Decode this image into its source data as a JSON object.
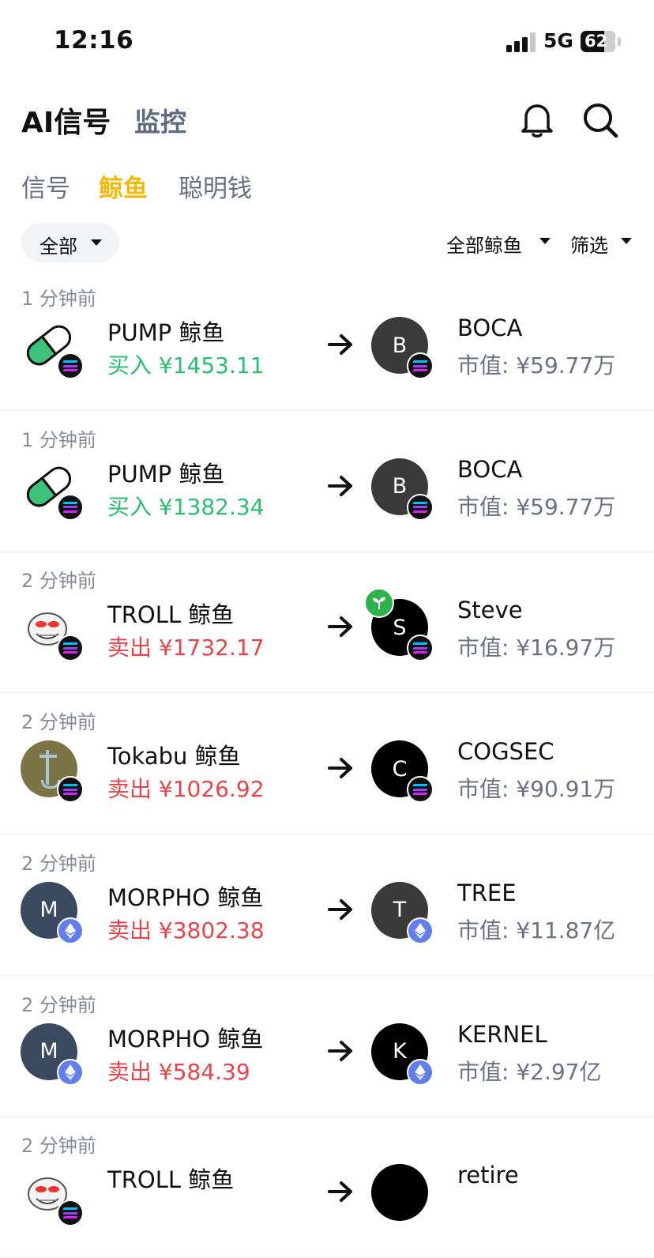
{
  "status_bar": {
    "time": "12:16",
    "network": "5G",
    "battery": "62"
  },
  "header": {
    "title": "AI信号",
    "tab_monitor": "监控"
  },
  "subtabs": {
    "signal": "信号",
    "whale": "鲸鱼",
    "smart_money": "聪明钱"
  },
  "filters": {
    "all": "全部",
    "all_whales": "全部鲸鱼",
    "filter": "筛选"
  },
  "colors": {
    "accent": "#f0b90b",
    "buy": "#2ebd6e",
    "sell": "#e5444c",
    "eth": "#627eea",
    "sol": "#111111"
  },
  "rows": [
    {
      "time": "1 分钟前",
      "whale": "PUMP 鲸鱼",
      "amount": "买入 ¥1453.11",
      "side": "buy",
      "avatar_icon": "pill-icon",
      "chain": "solana",
      "token_letter": "B",
      "token": "BOCA",
      "mcap": "市值: ¥59.77万"
    },
    {
      "time": "1 分钟前",
      "whale": "PUMP 鲸鱼",
      "amount": "买入 ¥1382.34",
      "side": "buy",
      "avatar_icon": "pill-icon",
      "chain": "solana",
      "token_letter": "B",
      "token": "BOCA",
      "mcap": "市值: ¥59.77万"
    },
    {
      "time": "2 分钟前",
      "whale": "TROLL 鲸鱼",
      "amount": "卖出 ¥1732.17",
      "side": "sell",
      "avatar_icon": "troll-face-icon",
      "chain": "solana",
      "token_letter": "S",
      "token": "Steve",
      "mcap": "市值: ¥16.97万"
    },
    {
      "time": "2 分钟前",
      "whale": "Tokabu 鲸鱼",
      "amount": "卖出 ¥1026.92",
      "side": "sell",
      "avatar_icon": "tokabu-logo",
      "chain": "solana",
      "token_letter": "C",
      "token": "COGSEC",
      "mcap": "市值: ¥90.91万"
    },
    {
      "time": "2 分钟前",
      "whale": "MORPHO 鲸鱼",
      "amount": "卖出 ¥3802.38",
      "side": "sell",
      "avatar_icon": "morpho-logo",
      "avatar_letter": "M",
      "chain": "ethereum",
      "token_letter": "T",
      "token": "TREE",
      "mcap": "市值: ¥11.87亿"
    },
    {
      "time": "2 分钟前",
      "whale": "MORPHO 鲸鱼",
      "amount": "卖出 ¥584.39",
      "side": "sell",
      "avatar_icon": "morpho-logo",
      "avatar_letter": "M",
      "chain": "ethereum",
      "token_letter": "K",
      "token": "KERNEL",
      "mcap": "市值: ¥2.97亿"
    },
    {
      "time": "2 分钟前",
      "whale": "TROLL 鲸鱼",
      "amount": "",
      "side": "sell",
      "avatar_icon": "troll-face-icon",
      "chain": "solana",
      "token_letter": "",
      "token": "retire",
      "mcap": ""
    }
  ]
}
